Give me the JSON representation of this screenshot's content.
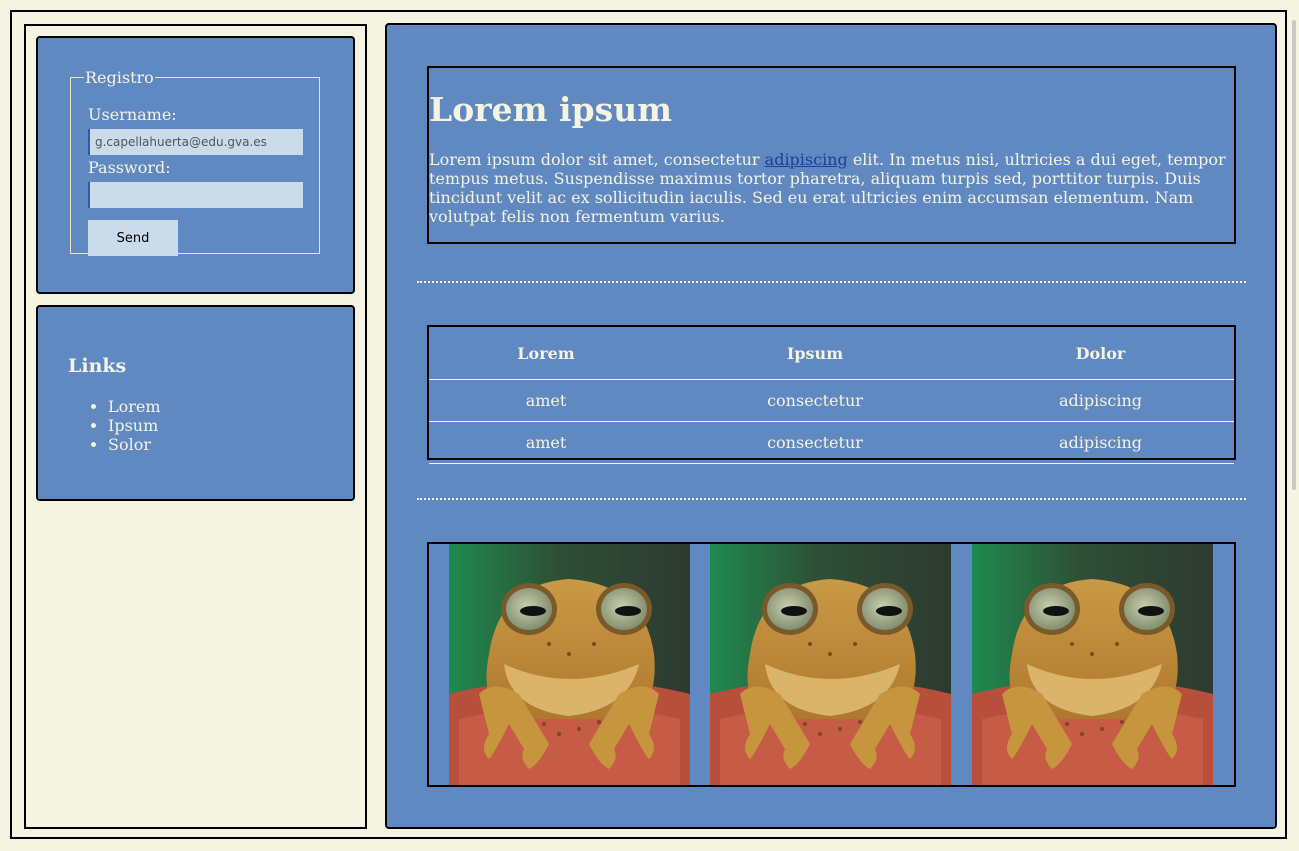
{
  "login": {
    "legend": "Registro",
    "username_label": "Username:",
    "username_value": "g.capellahuerta@edu.gva.es",
    "password_label": "Password:",
    "password_value": "",
    "send_label": "Send"
  },
  "links": {
    "title": "Links",
    "items": [
      "Lorem",
      "Ipsum",
      "Solor"
    ]
  },
  "article": {
    "title": "Lorem ipsum",
    "text_before": "Lorem ipsum dolor sit amet, consectetur ",
    "link_text": "adipiscing",
    "text_after": " elit. In metus nisi, ultricies a dui eget, tempor tempus metus. Suspendisse maximus tortor pharetra, aliquam turpis sed, porttitor turpis. Duis tincidunt velit ac ex sollicitudin iaculis. Sed eu erat ultricies enim accumsan elementum. Nam volutpat felis non fermentum varius."
  },
  "table": {
    "headers": [
      "Lorem",
      "Ipsum",
      "Dolor"
    ],
    "rows": [
      [
        "amet",
        "consectetur",
        "adipiscing"
      ],
      [
        "amet",
        "consectetur",
        "adipiscing"
      ]
    ]
  },
  "gallery": {
    "images": [
      "frog-photo",
      "frog-photo",
      "frog-photo"
    ]
  },
  "colors": {
    "background": "#f5f3e1",
    "panel": "#5f89c0",
    "input": "#cadbea",
    "link": "#1f3e9a"
  }
}
